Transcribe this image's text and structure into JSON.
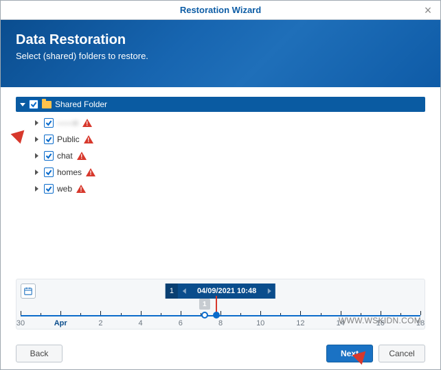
{
  "window": {
    "title": "Restoration Wizard"
  },
  "banner": {
    "heading": "Data Restoration",
    "subheading": "Select (shared) folders to restore."
  },
  "tree": {
    "root": {
      "label": "Shared Folder",
      "checked": true
    },
    "items": [
      {
        "label": "——n",
        "checked": true,
        "warn": true
      },
      {
        "label": "Public",
        "checked": true,
        "warn": true
      },
      {
        "label": "chat",
        "checked": true,
        "warn": true
      },
      {
        "label": "homes",
        "checked": true,
        "warn": true
      },
      {
        "label": "web",
        "checked": true,
        "warn": true
      }
    ]
  },
  "timeline": {
    "page": "1",
    "datetime": "04/09/2021 10:48",
    "handle": "1",
    "ticks": [
      "30",
      "Apr",
      "2",
      "4",
      "6",
      "8",
      "10",
      "12",
      "14",
      "16",
      "18"
    ],
    "current_month_index": 1,
    "marker_open_pct": 46,
    "marker_fill_pct": 49
  },
  "buttons": {
    "back": "Back",
    "next": "Next",
    "cancel": "Cancel"
  },
  "watermark": "WWW.WSKIDN.COM"
}
